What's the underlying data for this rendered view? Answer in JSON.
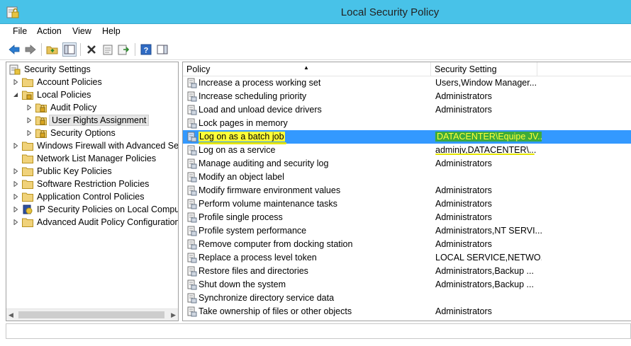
{
  "window": {
    "title": "Local Security Policy"
  },
  "menu": [
    "File",
    "Action",
    "View",
    "Help"
  ],
  "toolbar": {
    "buttons": [
      "back-icon",
      "forward-icon",
      "up-folder-icon",
      "show-hide-tree-icon",
      "delete-icon",
      "properties-icon",
      "export-list-icon",
      "help-icon",
      "show-action-pane-icon"
    ]
  },
  "tree": {
    "root": "Security Settings",
    "items": [
      {
        "label": "Account Policies",
        "level": 1,
        "expanded": false
      },
      {
        "label": "Local Policies",
        "level": 1,
        "expanded": true
      },
      {
        "label": "Audit Policy",
        "level": 2,
        "expanded": false
      },
      {
        "label": "User Rights Assignment",
        "level": 2,
        "expanded": false,
        "selected": true
      },
      {
        "label": "Security Options",
        "level": 2,
        "expanded": false
      },
      {
        "label": "Windows Firewall with Advanced Secu",
        "level": 1,
        "expanded": false
      },
      {
        "label": "Network List Manager Policies",
        "level": 1,
        "expanded": null
      },
      {
        "label": "Public Key Policies",
        "level": 1,
        "expanded": false
      },
      {
        "label": "Software Restriction Policies",
        "level": 1,
        "expanded": false
      },
      {
        "label": "Application Control Policies",
        "level": 1,
        "expanded": false
      },
      {
        "label": "IP Security Policies on Local Compute",
        "level": 1,
        "expanded": false
      },
      {
        "label": "Advanced Audit Policy Configuration",
        "level": 1,
        "expanded": false
      }
    ]
  },
  "list": {
    "columns": [
      "Policy",
      "Security Setting"
    ],
    "rows": [
      {
        "policy": "Increase a process working set",
        "setting": "Users,Window Manager..."
      },
      {
        "policy": "Increase scheduling priority",
        "setting": "Administrators"
      },
      {
        "policy": "Load and unload device drivers",
        "setting": "Administrators"
      },
      {
        "policy": "Lock pages in memory",
        "setting": ""
      },
      {
        "policy": "Log on as a batch job",
        "setting": "DATACENTER\\Equipe JV...",
        "selected": true
      },
      {
        "policy": "Log on as a service",
        "setting": "adminjv,DATACENTER\\..."
      },
      {
        "policy": "Manage auditing and security log",
        "setting": "Administrators"
      },
      {
        "policy": "Modify an object label",
        "setting": ""
      },
      {
        "policy": "Modify firmware environment values",
        "setting": "Administrators"
      },
      {
        "policy": "Perform volume maintenance tasks",
        "setting": "Administrators"
      },
      {
        "policy": "Profile single process",
        "setting": "Administrators"
      },
      {
        "policy": "Profile system performance",
        "setting": "Administrators,NT SERVI..."
      },
      {
        "policy": "Remove computer from docking station",
        "setting": "Administrators"
      },
      {
        "policy": "Replace a process level token",
        "setting": "LOCAL SERVICE,NETWO..."
      },
      {
        "policy": "Restore files and directories",
        "setting": "Administrators,Backup ..."
      },
      {
        "policy": "Shut down the system",
        "setting": "Administrators,Backup ..."
      },
      {
        "policy": "Synchronize directory service data",
        "setting": ""
      },
      {
        "policy": "Take ownership of files or other objects",
        "setting": "Administrators"
      }
    ]
  },
  "colors": {
    "titlebar": "#48c2e8",
    "selection": "#3399ff",
    "highlight": "#ffff38"
  }
}
